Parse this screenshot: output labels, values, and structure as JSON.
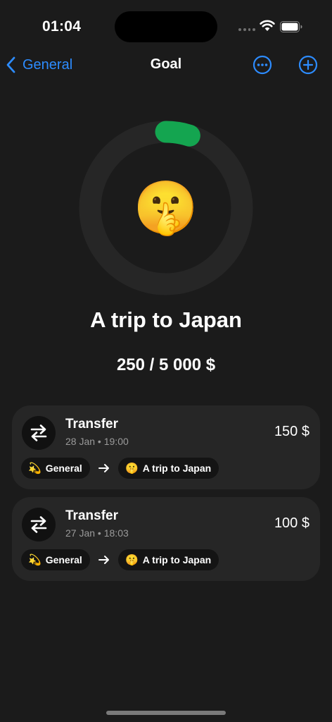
{
  "status_bar": {
    "time": "01:04"
  },
  "nav": {
    "back_label": "General",
    "title": "Goal"
  },
  "goal": {
    "emoji": "🤫",
    "title": "A trip to Japan",
    "amount_text": "250 / 5 000 $",
    "progress": 0.05,
    "ring_color": "#14a550"
  },
  "transactions": [
    {
      "title": "Transfer",
      "date": "28 Jan",
      "time": "19:00",
      "amount": "150 $",
      "from": {
        "emoji": "💫",
        "label": "General"
      },
      "to": {
        "emoji": "🤫",
        "label": "A trip to Japan"
      }
    },
    {
      "title": "Transfer",
      "date": "27 Jan",
      "time": "18:03",
      "amount": "100 $",
      "from": {
        "emoji": "💫",
        "label": "General"
      },
      "to": {
        "emoji": "🤫",
        "label": "A trip to Japan"
      }
    }
  ],
  "colors": {
    "accent": "#2d8cff",
    "background": "#1b1b1b",
    "card": "#262626"
  }
}
